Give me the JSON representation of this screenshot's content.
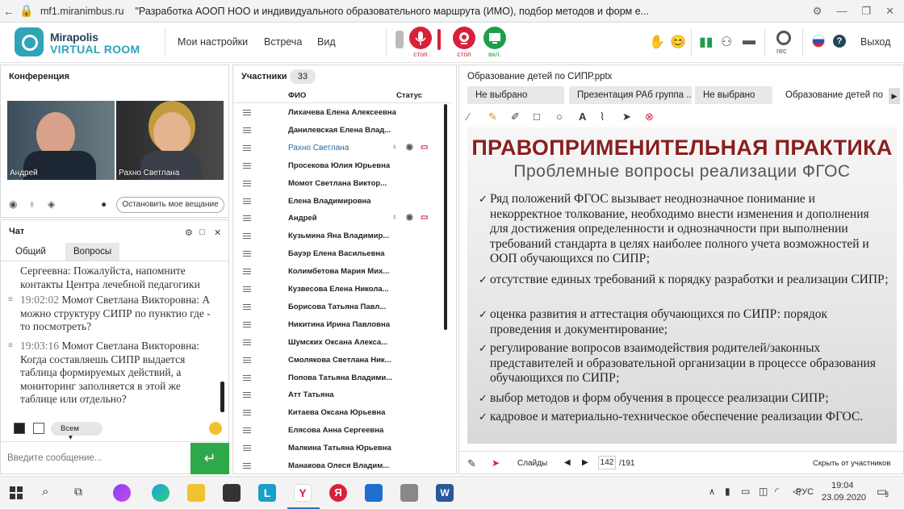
{
  "browser": {
    "url": "mf1.miranimbus.ru",
    "title": "\"Разработка АООП НОО и индивидуального образовательного маршрута (ИМО), подбор методов и форм е..."
  },
  "header": {
    "logo_line1": "Mirapolis",
    "logo_line2": "VIRTUAL ROOM",
    "menu": [
      "Мои настройки",
      "Встреча",
      "Вид"
    ],
    "mic_caption": "стоп",
    "cam_caption": "стоп",
    "screen_caption": "вкл.",
    "rec_caption": "rec",
    "exit_label": "Выход"
  },
  "conference": {
    "title": "Конференция",
    "videos": [
      {
        "name": "Андрей"
      },
      {
        "name": "Рахно Светлана"
      }
    ],
    "stop_broadcast_label": "Остановить мое вещание"
  },
  "chat": {
    "title": "Чат",
    "tabs": [
      "Общий",
      "Вопросы"
    ],
    "messages": [
      {
        "time": "",
        "author": "",
        "text": "Сергеевна: Пожалуйста, напомните контакты Центра лечебной педагогики"
      },
      {
        "time": "19:02:02",
        "author": "Момот Светлана",
        "text": "Викторовна: А можно структуру СИПР по пунктиo где - то посмотреть?"
      },
      {
        "time": "19:03:16",
        "author": "Момот Светлана",
        "text": "Викторовна: Когда составляешь СИПР выдается таблица формируемых действий, а мониторинг заполняется в этой же таблице или отдельно?"
      }
    ],
    "recipient": "Всем",
    "input_placeholder": "Введите сообщение..."
  },
  "participants": {
    "title": "Участники",
    "count": "33",
    "col_name": "ФИО",
    "col_status": "Статус",
    "list": [
      "Лихачева Елена Алексеевна",
      "Данилевская Елена Влад...",
      "Рахно Светлана",
      "Просекова Юлия Юрьевна",
      "Момот Светлана Виктор...",
      "Елена Владимировна",
      "Андрей",
      "Кузьмина Яна Владимир...",
      "Бауэр Елена Васильевна",
      "Колимбетова Мария Мих...",
      "Кузвесова Елена Никола...",
      "Борисова Татьяна Павл...",
      "Никитина Ирина Павловна",
      "Шумских Оксана Алекса...",
      "Смолякова Светлана Ник...",
      "Попова Татьяна Владими...",
      "Атт Татьяна",
      "Китаева Оксана Юрьевна",
      "Елясова Анна Сергеевна",
      "Малкина Татьяна Юрьевна",
      "Манакова Олеся Владим..."
    ]
  },
  "presentation": {
    "title": "Образование детей по СИПР.pptx",
    "tabs": [
      "Не выбрано",
      "Презентация РАб группа ...",
      "Не выбрано",
      "Образование детей по"
    ],
    "slide": {
      "title": "ПРАВОПРИМЕНИТЕЛЬНАЯ ПРАКТИКА",
      "subtitle": "Проблемные вопросы реализации ФГОС",
      "bullets": [
        "Ряд положений ФГОС вызывает неоднозначное понимание и некорректное толкование, необходимо внести изменения и дополнения для достижения определенности и однозначности при выполнении требований стандарта в целях наиболее полного учета возможностей и ООП обучающихся по СИПР;",
        "отсутствие единых требований к порядку разработки и реализации СИПР;",
        "оценка развития и аттестация обучающихся по СИПР: порядок проведения и документирование;",
        "регулирование вопросов взаимодействия родителей/законных представителей и образовательной организации в процессе образования обучающихся по СИПР;",
        "выбор методов и форм обучения в процессе реализации СИПР;",
        "кадровое и материально-техническое обеспечение реализации ФГОС."
      ]
    },
    "footer": {
      "slides_label": "Слайды",
      "page": "142",
      "total": "/191",
      "hide_label": "Скрыть от участников"
    }
  },
  "taskbar": {
    "lang": "РУС",
    "time": "19:04",
    "date": "23.09.2020",
    "notifications": "3"
  }
}
